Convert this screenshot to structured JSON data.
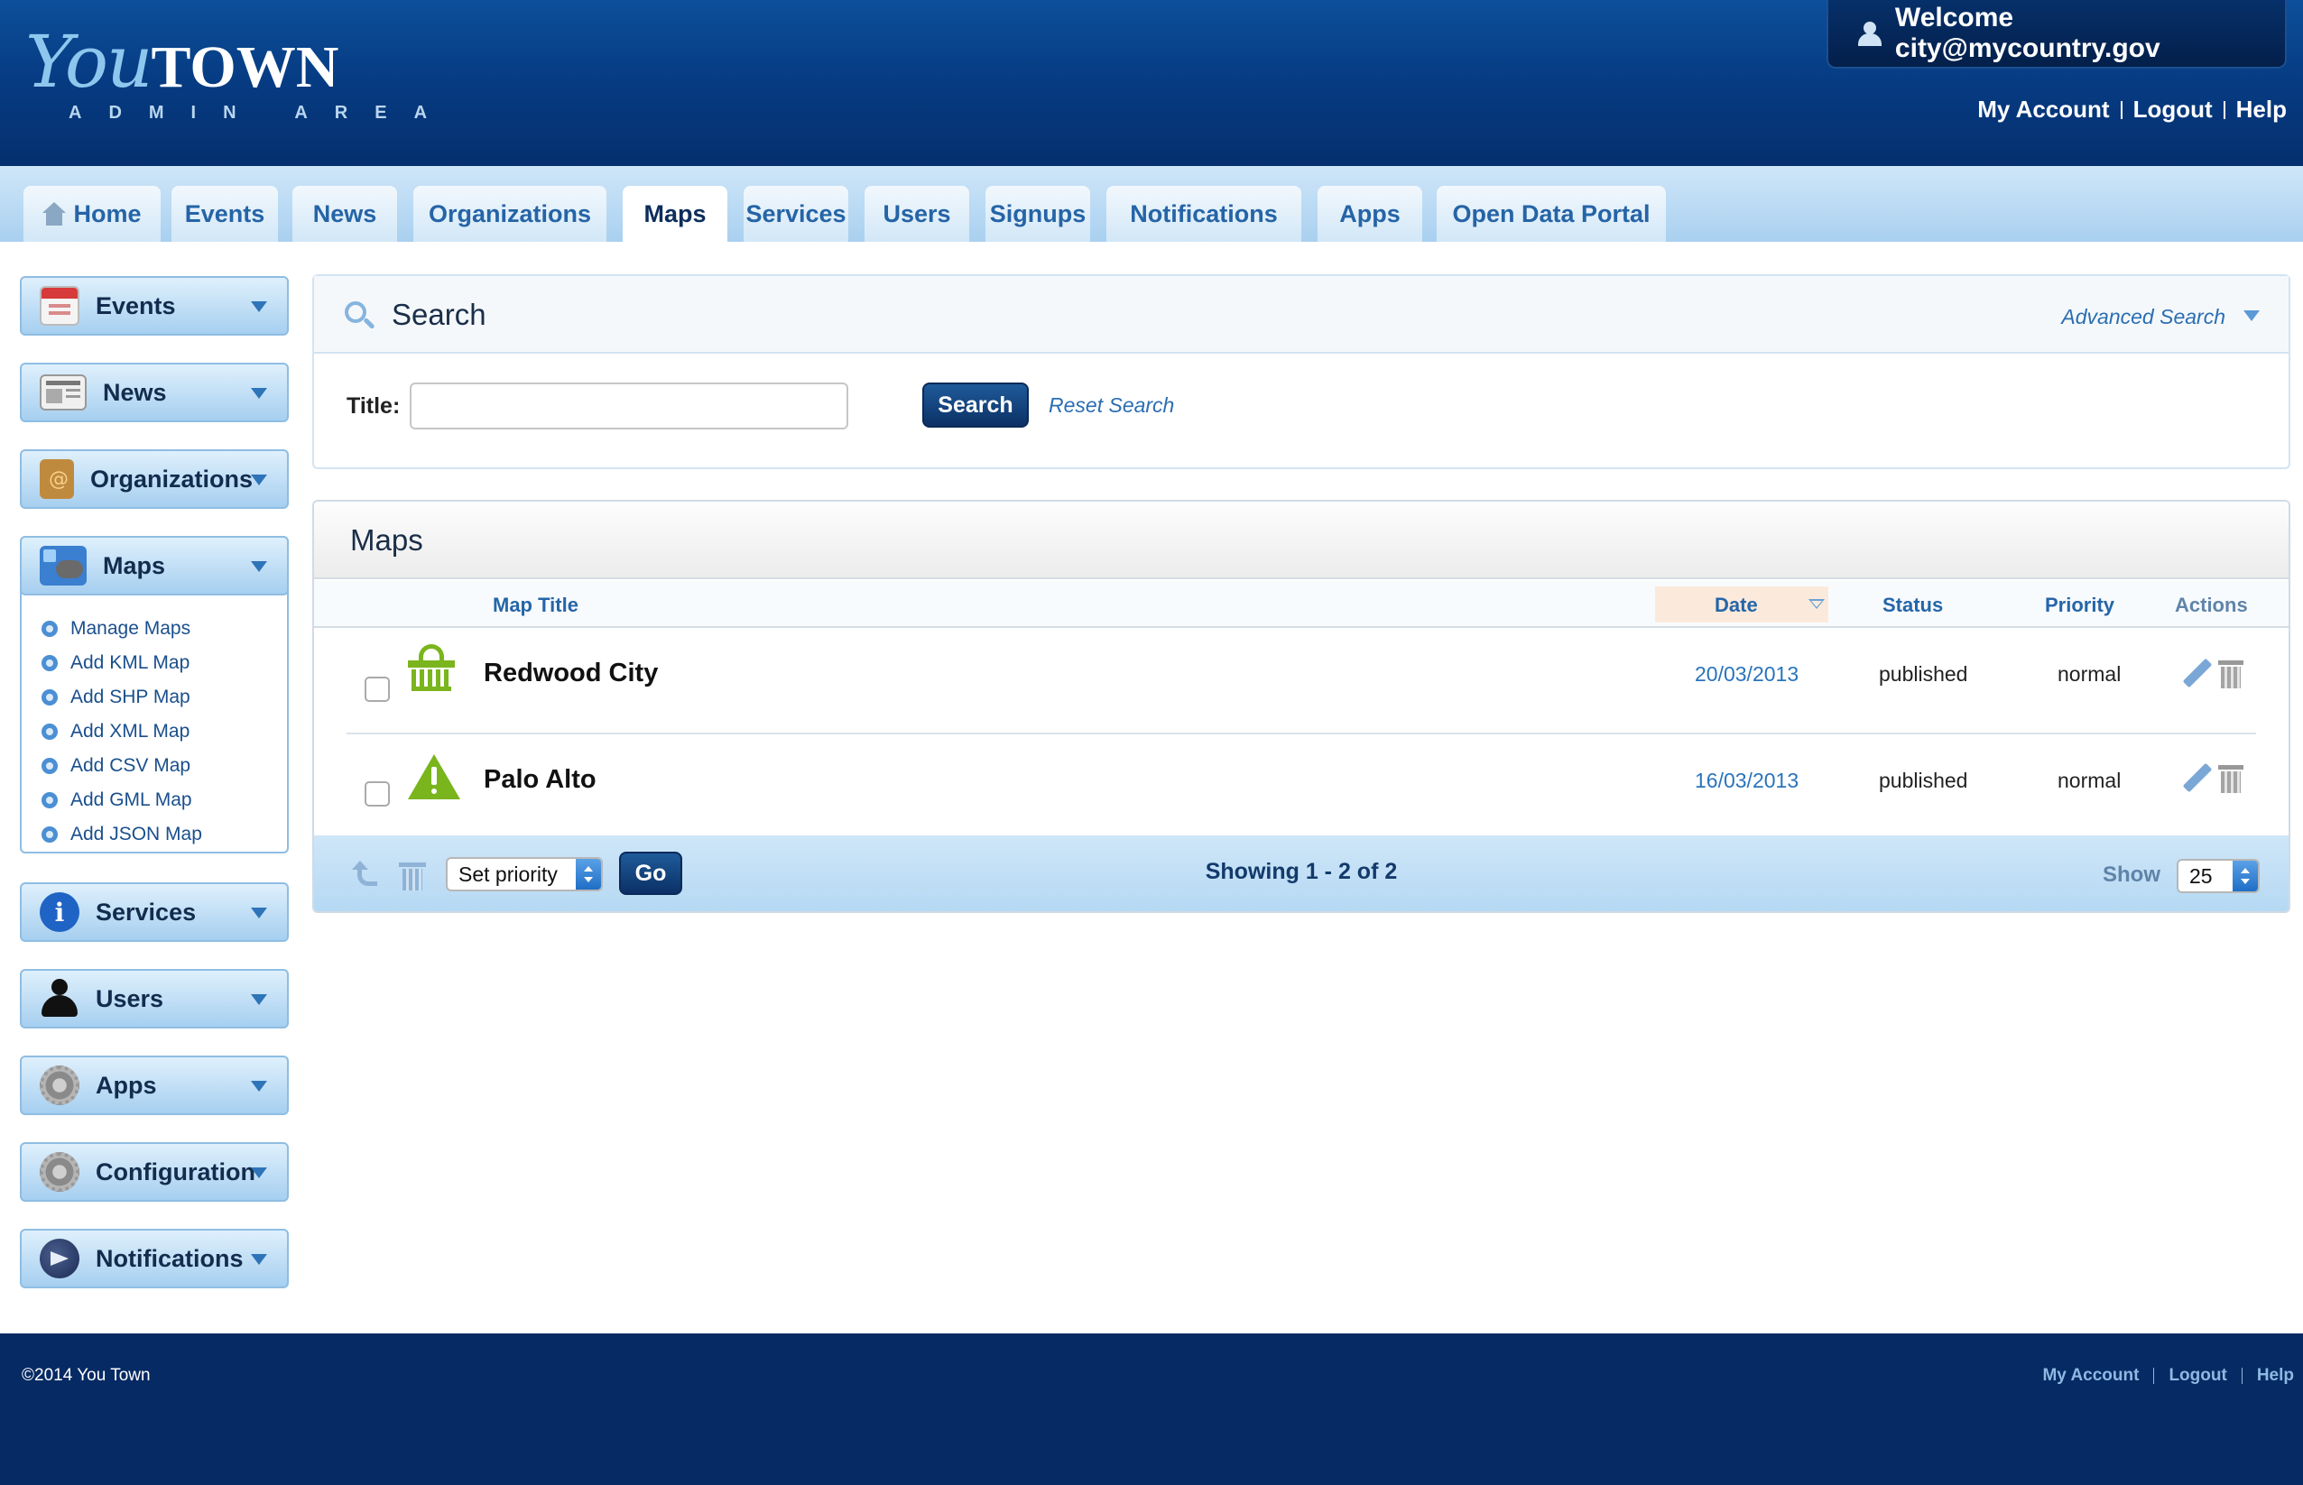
{
  "brand": {
    "logo_you": "You",
    "logo_town": "TOWN",
    "logo_sub": "ADMIN AREA"
  },
  "header": {
    "welcome": "Welcome city@mycountry.gov",
    "links": {
      "account": "My Account",
      "logout": "Logout",
      "help": "Help"
    }
  },
  "tabs": [
    "Home",
    "Events",
    "News",
    "Organizations",
    "Maps",
    "Services",
    "Users",
    "Signups",
    "Notifications",
    "Apps",
    "Open Data Portal"
  ],
  "active_tab": "Maps",
  "sidebar": {
    "events": "Events",
    "news": "News",
    "organizations": "Organizations",
    "maps": "Maps",
    "maps_items": [
      "Manage Maps",
      "Add KML Map",
      "Add SHP Map",
      "Add XML Map",
      "Add CSV Map",
      "Add GML Map",
      "Add JSON Map"
    ],
    "services": "Services",
    "users": "Users",
    "apps": "Apps",
    "configuration": "Configuration",
    "notifications": "Notifications"
  },
  "search": {
    "heading": "Search",
    "advanced": "Advanced Search",
    "title_label": "Title:",
    "title_value": "",
    "button": "Search",
    "reset": "Reset Search"
  },
  "maps": {
    "heading": "Maps",
    "columns": {
      "title": "Map Title",
      "date": "Date",
      "status": "Status",
      "priority": "Priority",
      "actions": "Actions"
    },
    "rows": [
      {
        "title": "Redwood City",
        "date": "20/03/2013",
        "status": "published",
        "priority": "normal",
        "icon": "basket-icon"
      },
      {
        "title": "Palo Alto",
        "date": "16/03/2013",
        "status": "published",
        "priority": "normal",
        "icon": "warning-icon"
      }
    ],
    "footer": {
      "set_priority": "Set priority",
      "go": "Go",
      "showing": "Showing 1 - 2 of 2",
      "show_label": "Show",
      "per_page": "25"
    }
  },
  "footer": {
    "copyright": "©2014 You Town",
    "links": {
      "account": "My Account",
      "logout": "Logout",
      "help": "Help"
    }
  },
  "colors": {
    "header": "#063b82",
    "footer": "#062a63",
    "accent": "#2566a8",
    "icon_green": "#7ab51d"
  }
}
